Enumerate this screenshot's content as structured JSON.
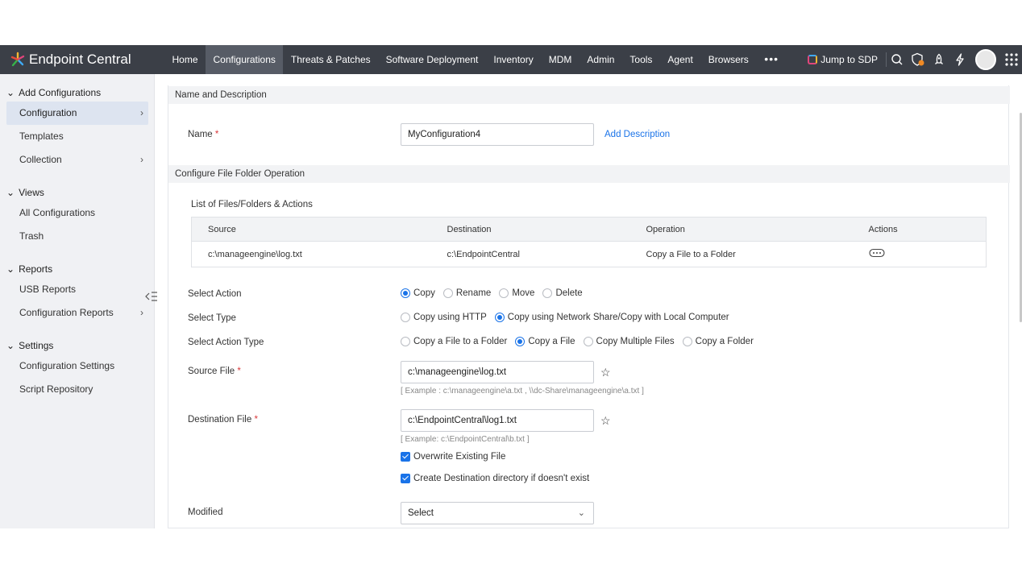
{
  "brand": {
    "name": "Endpoint Central"
  },
  "nav": {
    "items": [
      "Home",
      "Configurations",
      "Threats & Patches",
      "Software Deployment",
      "Inventory",
      "MDM",
      "Admin",
      "Tools",
      "Agent",
      "Browsers"
    ],
    "more": "•••",
    "jump_label": "Jump to SDP"
  },
  "sidebar": {
    "add_configurations": "Add Configurations",
    "configuration": "Configuration",
    "templates": "Templates",
    "collection": "Collection",
    "views": "Views",
    "all_configurations": "All Configurations",
    "trash": "Trash",
    "reports": "Reports",
    "usb_reports": "USB Reports",
    "configuration_reports": "Configuration Reports",
    "settings": "Settings",
    "configuration_settings": "Configuration Settings",
    "script_repository": "Script Repository"
  },
  "form": {
    "section_name": "Name and Description",
    "name_label": "Name",
    "name_value": "MyConfiguration4",
    "add_description": "Add Description",
    "section_operation": "Configure File Folder Operation",
    "list_title": "List of Files/Folders & Actions",
    "table": {
      "headers": [
        "Source",
        "Destination",
        "Operation",
        "Actions"
      ],
      "rows": [
        [
          "c:\\manageengine\\log.txt",
          "c:\\EndpointCentral",
          "Copy a File to a Folder"
        ]
      ]
    },
    "select_action": {
      "label": "Select Action",
      "options": [
        "Copy",
        "Rename",
        "Move",
        "Delete"
      ],
      "selected": "Copy"
    },
    "select_type": {
      "label": "Select Type",
      "options": [
        "Copy using HTTP",
        "Copy using Network Share/Copy with Local Computer"
      ],
      "selected": "Copy using Network Share/Copy with Local Computer"
    },
    "select_action_type": {
      "label": "Select Action Type",
      "options": [
        "Copy a File to a Folder",
        "Copy a File",
        "Copy Multiple Files",
        "Copy a Folder"
      ],
      "selected": "Copy a File"
    },
    "source_file": {
      "label": "Source File",
      "value": "c:\\manageengine\\log.txt",
      "hint": "[ Example : c:\\manageengine\\a.txt , \\\\dc-Share\\manageengine\\a.txt ]"
    },
    "destination_file": {
      "label": "Destination File",
      "value": "c:\\EndpointCentral\\log1.txt",
      "hint": "[ Example: c:\\EndpointCentral\\b.txt ]"
    },
    "overwrite": "Overwrite Existing File",
    "create_dir": "Create Destination directory if doesn't exist",
    "modified": {
      "label": "Modified",
      "value": "Select"
    },
    "required_mark": "*"
  },
  "colors": {
    "topbar": "#3b3f47",
    "accent": "#1a73e8",
    "sidebar": "#f0f1f4"
  }
}
